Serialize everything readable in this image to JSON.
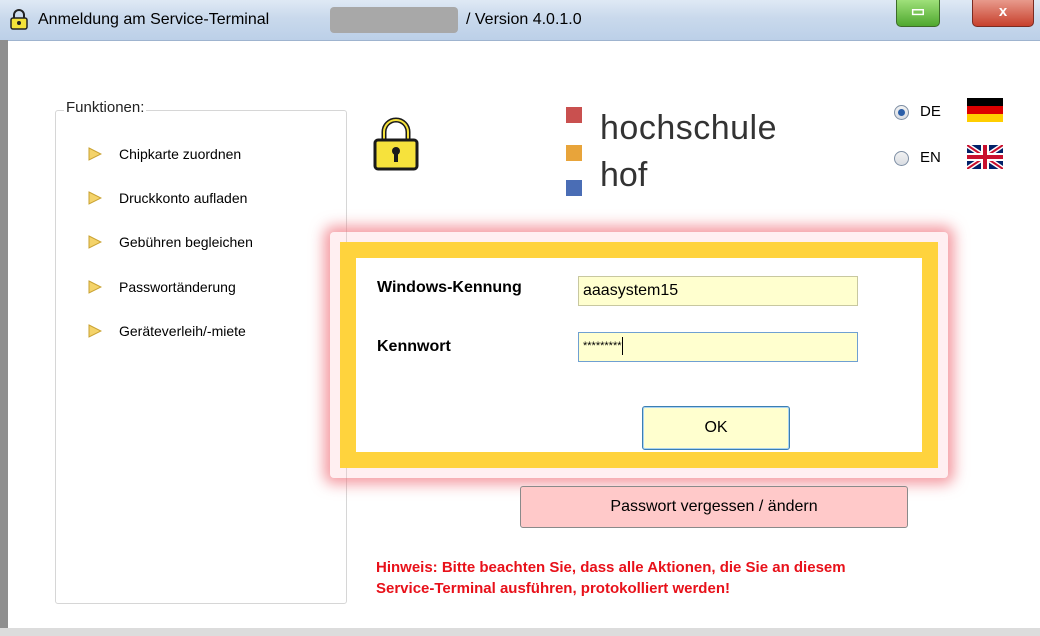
{
  "window": {
    "title": "Anmeldung am Service-Terminal",
    "version": "/ Version 4.0.1.0",
    "minimize_glyph": "▭",
    "close_glyph": "x"
  },
  "functions": {
    "legend": "Funktionen:",
    "items": [
      {
        "label": "Chipkarte zuordnen",
        "icon": "arrow-right-icon"
      },
      {
        "label": "Druckkonto aufladen",
        "icon": "arrow-right-icon"
      },
      {
        "label": "Gebühren begleichen",
        "icon": "arrow-right-icon"
      },
      {
        "label": "Passwortänderung",
        "icon": "arrow-right-icon"
      },
      {
        "label": "Geräteverleih/-miete",
        "icon": "arrow-right-icon"
      }
    ]
  },
  "logo": {
    "line1": "hochschule",
    "line2": "hof",
    "colors": [
      "#c9504f",
      "#e8a43a",
      "#4a6db5"
    ]
  },
  "language": {
    "options": [
      {
        "code": "DE",
        "selected": true,
        "flag": "germany-flag-icon"
      },
      {
        "code": "EN",
        "selected": false,
        "flag": "uk-flag-icon"
      }
    ]
  },
  "login": {
    "username_label": "Windows-Kennung",
    "username_value": "aaasystem15",
    "password_label": "Kennwort",
    "password_value": "*********",
    "ok_label": "OK"
  },
  "forgot_label": "Passwort vergessen / ändern",
  "notice": {
    "line1": "Hinweis: Bitte beachten Sie, dass alle Aktionen, die Sie an diesem",
    "line2": "Service-Terminal ausführen, protokolliert werden!",
    "color": "#e8111a"
  },
  "accent": {
    "highlight_frame": "#ffd33d",
    "input_bg": "#ffffcf"
  }
}
